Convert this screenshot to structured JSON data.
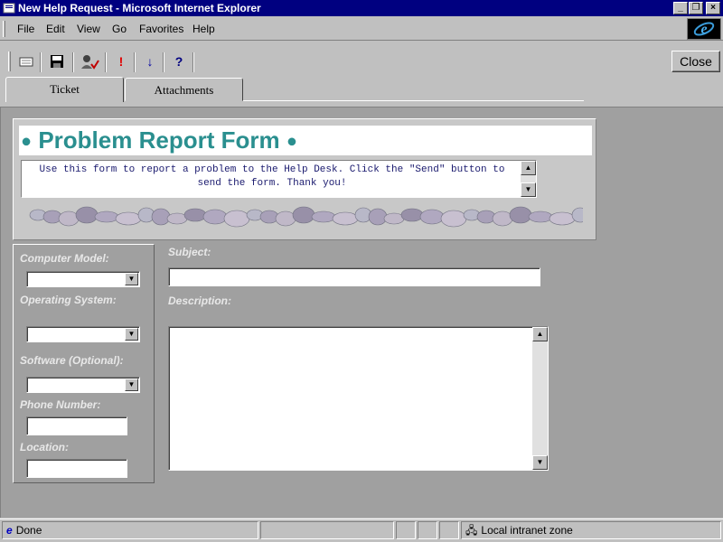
{
  "window": {
    "title": "New Help Request - Microsoft Internet Explorer"
  },
  "menu": [
    "File",
    "Edit",
    "View",
    "Go",
    "Favorites",
    "Help"
  ],
  "toolbar": {
    "icons": [
      "mail-icon",
      "save-icon",
      "check-names-icon",
      "importance-icon",
      "low-priority-icon",
      "help-icon"
    ],
    "close_label": "Close"
  },
  "tabs": [
    "Ticket",
    "Attachments"
  ],
  "form": {
    "title": "Problem Report Form",
    "intro": "Use this form to report a problem to the Help Desk.  Click the \"Send\" button to send the form.  Thank you!",
    "fields": {
      "computer_model": "Computer Model:",
      "operating_system": "Operating System:",
      "software": "Software (Optional):",
      "phone": "Phone Number:",
      "location": "Location:",
      "subject": "Subject:",
      "description": "Description:"
    }
  },
  "status": {
    "text": "Done",
    "zone": "Local intranet zone"
  },
  "colors": {
    "title_bar": "#000080",
    "form_title": "#2a8f8f",
    "content_bg": "#a0a0a0"
  }
}
